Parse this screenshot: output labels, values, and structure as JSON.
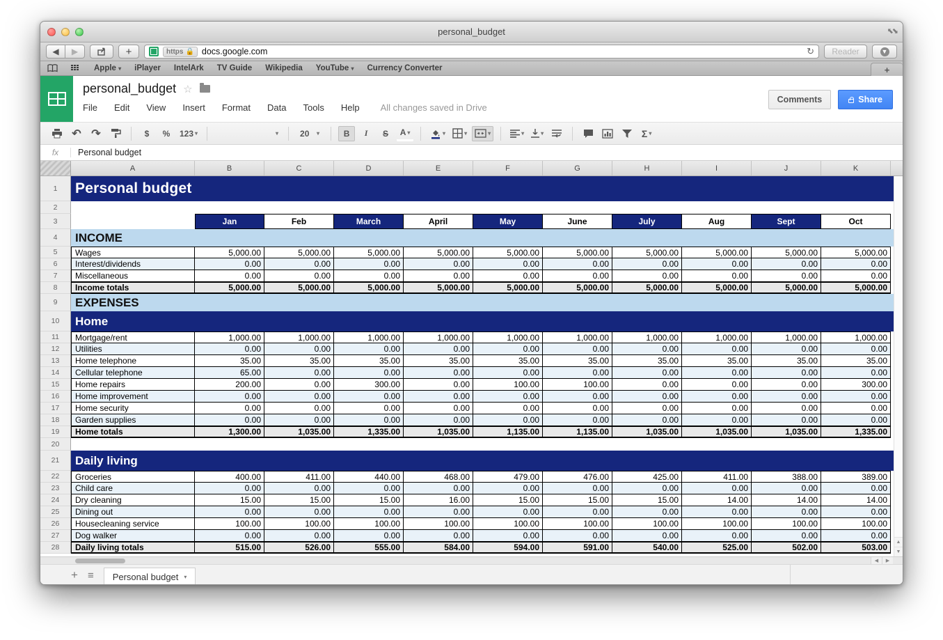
{
  "browser": {
    "window_title": "personal_budget",
    "url": {
      "scheme_badge": "https",
      "host": "docs.google.com"
    },
    "reader_label": "Reader",
    "bookmarks": [
      {
        "label": "Apple",
        "dropdown": true
      },
      {
        "label": "iPlayer",
        "dropdown": false
      },
      {
        "label": "IntelArk",
        "dropdown": false
      },
      {
        "label": "TV Guide",
        "dropdown": false
      },
      {
        "label": "Wikipedia",
        "dropdown": false
      },
      {
        "label": "YouTube",
        "dropdown": true
      },
      {
        "label": "Currency Converter",
        "dropdown": false
      }
    ]
  },
  "icons": {
    "back": "◀",
    "forward": "▶",
    "plus": "+",
    "reload": "↻",
    "download": "⬇",
    "expand": "⤡",
    "undo": "↶",
    "redo": "↷",
    "dropdown": "▾",
    "star": "☆",
    "hamburger": "≡",
    "up": "▲",
    "down": "▼",
    "left": "◀",
    "right": "▶"
  },
  "sheets": {
    "doc_title": "personal_budget",
    "menu": [
      "File",
      "Edit",
      "View",
      "Insert",
      "Format",
      "Data",
      "Tools",
      "Help"
    ],
    "status": "All changes saved in Drive",
    "comments_label": "Comments",
    "share_label": "Share",
    "toolbar": {
      "currency": "$",
      "percent": "%",
      "number_format": "123",
      "font_size": "20",
      "bold": "B",
      "italic": "I",
      "strikethrough": "S",
      "text_color": "A",
      "functions": "Σ"
    },
    "formula_bar": {
      "fx": "fx",
      "value": "Personal budget"
    },
    "sheet_tab": {
      "label": "Personal budget"
    },
    "grid": {
      "columns": [
        "A",
        "B",
        "C",
        "D",
        "E",
        "F",
        "G",
        "H",
        "I",
        "J",
        "K"
      ],
      "rows": [
        {
          "n": 1,
          "type": "banner",
          "big": true,
          "label": "Personal budget"
        },
        {
          "n": 2,
          "type": "empty"
        },
        {
          "n": 3,
          "type": "months",
          "values": [
            "Jan",
            "Feb",
            "March",
            "April",
            "May",
            "June",
            "July",
            "Aug",
            "Sept",
            "Oct"
          ]
        },
        {
          "n": 4,
          "type": "section",
          "label": "INCOME"
        },
        {
          "n": 5,
          "type": "data",
          "label": "Wages",
          "values": [
            "5,000.00",
            "5,000.00",
            "5,000.00",
            "5,000.00",
            "5,000.00",
            "5,000.00",
            "5,000.00",
            "5,000.00",
            "5,000.00",
            "5,000.00"
          ]
        },
        {
          "n": 6,
          "type": "data",
          "label": "Interest/dividends",
          "values": [
            "0.00",
            "0.00",
            "0.00",
            "0.00",
            "0.00",
            "0.00",
            "0.00",
            "0.00",
            "0.00",
            "0.00"
          ]
        },
        {
          "n": 7,
          "type": "data",
          "label": "Miscellaneous",
          "values": [
            "0.00",
            "0.00",
            "0.00",
            "0.00",
            "0.00",
            "0.00",
            "0.00",
            "0.00",
            "0.00",
            "0.00"
          ]
        },
        {
          "n": 8,
          "type": "total",
          "label": "Income totals",
          "values": [
            "5,000.00",
            "5,000.00",
            "5,000.00",
            "5,000.00",
            "5,000.00",
            "5,000.00",
            "5,000.00",
            "5,000.00",
            "5,000.00",
            "5,000.00"
          ]
        },
        {
          "n": 9,
          "type": "section",
          "label": "EXPENSES"
        },
        {
          "n": 10,
          "type": "banner",
          "label": "Home"
        },
        {
          "n": 11,
          "type": "data",
          "label": "Mortgage/rent",
          "values": [
            "1,000.00",
            "1,000.00",
            "1,000.00",
            "1,000.00",
            "1,000.00",
            "1,000.00",
            "1,000.00",
            "1,000.00",
            "1,000.00",
            "1,000.00"
          ]
        },
        {
          "n": 12,
          "type": "data",
          "label": "Utilities",
          "values": [
            "0.00",
            "0.00",
            "0.00",
            "0.00",
            "0.00",
            "0.00",
            "0.00",
            "0.00",
            "0.00",
            "0.00"
          ]
        },
        {
          "n": 13,
          "type": "data",
          "label": "Home telephone",
          "values": [
            "35.00",
            "35.00",
            "35.00",
            "35.00",
            "35.00",
            "35.00",
            "35.00",
            "35.00",
            "35.00",
            "35.00"
          ]
        },
        {
          "n": 14,
          "type": "data",
          "label": "Cellular telephone",
          "values": [
            "65.00",
            "0.00",
            "0.00",
            "0.00",
            "0.00",
            "0.00",
            "0.00",
            "0.00",
            "0.00",
            "0.00"
          ]
        },
        {
          "n": 15,
          "type": "data",
          "label": "Home repairs",
          "values": [
            "200.00",
            "0.00",
            "300.00",
            "0.00",
            "100.00",
            "100.00",
            "0.00",
            "0.00",
            "0.00",
            "300.00"
          ]
        },
        {
          "n": 16,
          "type": "data",
          "label": "Home improvement",
          "values": [
            "0.00",
            "0.00",
            "0.00",
            "0.00",
            "0.00",
            "0.00",
            "0.00",
            "0.00",
            "0.00",
            "0.00"
          ]
        },
        {
          "n": 17,
          "type": "data",
          "label": "Home security",
          "values": [
            "0.00",
            "0.00",
            "0.00",
            "0.00",
            "0.00",
            "0.00",
            "0.00",
            "0.00",
            "0.00",
            "0.00"
          ]
        },
        {
          "n": 18,
          "type": "data",
          "label": "Garden supplies",
          "values": [
            "0.00",
            "0.00",
            "0.00",
            "0.00",
            "0.00",
            "0.00",
            "0.00",
            "0.00",
            "0.00",
            "0.00"
          ]
        },
        {
          "n": 19,
          "type": "total",
          "label": "Home totals",
          "values": [
            "1,300.00",
            "1,035.00",
            "1,335.00",
            "1,035.00",
            "1,135.00",
            "1,135.00",
            "1,035.00",
            "1,035.00",
            "1,035.00",
            "1,335.00"
          ]
        },
        {
          "n": 20,
          "type": "empty"
        },
        {
          "n": 21,
          "type": "banner",
          "label": "Daily living"
        },
        {
          "n": 22,
          "type": "data",
          "label": "Groceries",
          "values": [
            "400.00",
            "411.00",
            "440.00",
            "468.00",
            "479.00",
            "476.00",
            "425.00",
            "411.00",
            "388.00",
            "389.00"
          ]
        },
        {
          "n": 23,
          "type": "data",
          "label": "Child care",
          "values": [
            "0.00",
            "0.00",
            "0.00",
            "0.00",
            "0.00",
            "0.00",
            "0.00",
            "0.00",
            "0.00",
            "0.00"
          ]
        },
        {
          "n": 24,
          "type": "data",
          "label": "Dry cleaning",
          "values": [
            "15.00",
            "15.00",
            "15.00",
            "16.00",
            "15.00",
            "15.00",
            "15.00",
            "14.00",
            "14.00",
            "14.00"
          ]
        },
        {
          "n": 25,
          "type": "data",
          "label": "Dining out",
          "values": [
            "0.00",
            "0.00",
            "0.00",
            "0.00",
            "0.00",
            "0.00",
            "0.00",
            "0.00",
            "0.00",
            "0.00"
          ]
        },
        {
          "n": 26,
          "type": "data",
          "label": "Housecleaning service",
          "values": [
            "100.00",
            "100.00",
            "100.00",
            "100.00",
            "100.00",
            "100.00",
            "100.00",
            "100.00",
            "100.00",
            "100.00"
          ]
        },
        {
          "n": 27,
          "type": "data",
          "label": "Dog walker",
          "values": [
            "0.00",
            "0.00",
            "0.00",
            "0.00",
            "0.00",
            "0.00",
            "0.00",
            "0.00",
            "0.00",
            "0.00"
          ]
        },
        {
          "n": 28,
          "type": "total",
          "label": "Daily living totals",
          "values": [
            "515.00",
            "526.00",
            "555.00",
            "584.00",
            "594.00",
            "591.00",
            "540.00",
            "525.00",
            "502.00",
            "503.00"
          ]
        }
      ]
    },
    "colors": {
      "banner_navy": "#15267d",
      "section_blue": "#bdd9ee",
      "alt_row": "#e9f2f9",
      "total_gray": "#e8e8e8",
      "share_blue": "#4285f4",
      "sheets_green": "#23a566"
    }
  }
}
